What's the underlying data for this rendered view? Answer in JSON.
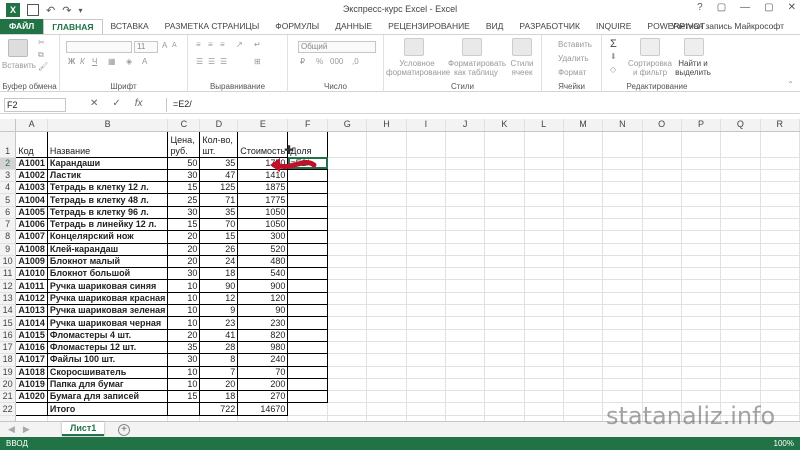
{
  "window": {
    "title": "Экспресс-курс Excel - Excel",
    "controls": [
      "?",
      "▢",
      "—",
      "▢",
      "✕"
    ]
  },
  "ribbon_tabs": {
    "file": "ФАЙЛ",
    "items": [
      "ГЛАВНАЯ",
      "ВСТАВКА",
      "РАЗМЕТКА СТРАНИЦЫ",
      "ФОРМУЛЫ",
      "ДАННЫЕ",
      "РЕЦЕНЗИРОВАНИЕ",
      "ВИД",
      "РАЗРАБОТЧИК",
      "INQUIRE",
      "POWERPIVOT"
    ],
    "active": "ГЛАВНАЯ",
    "account": "Учетная запись Майкрософт"
  },
  "ribbon": {
    "groups": {
      "clipboard": "Буфер обмена",
      "font": "Шрифт",
      "alignment": "Выравнивание",
      "number": "Число",
      "styles": "Стили",
      "cells": "Ячейки",
      "editing": "Редактирование"
    },
    "paste": "Вставить",
    "font_size": "11",
    "number_format": "Общий",
    "cond_format": "Условное форматирование",
    "format_table": "Форматировать как таблицу",
    "cell_styles": "Стили ячеек",
    "insert": "Вставить",
    "delete": "Удалить",
    "format": "Формат",
    "sort_filter": "Сортировка и фильтр",
    "find_select": "Найти и выделить"
  },
  "formula_bar": {
    "name_box": "F2",
    "formula": "=E2/",
    "cancel": "✕",
    "enter": "✓",
    "fx": "fx"
  },
  "grid": {
    "columns": [
      "A",
      "B",
      "C",
      "D",
      "E",
      "F",
      "G",
      "H",
      "I",
      "J",
      "K",
      "L",
      "M",
      "N",
      "O",
      "P",
      "Q",
      "R"
    ],
    "selected_column": "F",
    "selected_row": "2",
    "header": {
      "row": "1",
      "code": "Код",
      "name": "Название",
      "price_l1": "Цена,",
      "price_l2": "руб.",
      "qty_l1": "Кол-во,",
      "qty_l2": "шт.",
      "cost": "Стоимость",
      "share": "Доля"
    },
    "rows": [
      {
        "r": "2",
        "code": "А1001",
        "name": "Карандаши",
        "price": "50",
        "qty": "35",
        "cost": "1750",
        "f": "=E2/"
      },
      {
        "r": "3",
        "code": "А1002",
        "name": "Ластик",
        "price": "30",
        "qty": "47",
        "cost": "1410",
        "f": ""
      },
      {
        "r": "4",
        "code": "А1003",
        "name": "Тетрадь в клетку 12 л.",
        "price": "15",
        "qty": "125",
        "cost": "1875",
        "f": ""
      },
      {
        "r": "5",
        "code": "А1004",
        "name": "Тетрадь в клетку 48 л.",
        "price": "25",
        "qty": "71",
        "cost": "1775",
        "f": ""
      },
      {
        "r": "6",
        "code": "А1005",
        "name": "Тетрадь в клетку 96 л.",
        "price": "30",
        "qty": "35",
        "cost": "1050",
        "f": ""
      },
      {
        "r": "7",
        "code": "А1006",
        "name": "Тетрадь в линейку 12 л.",
        "price": "15",
        "qty": "70",
        "cost": "1050",
        "f": ""
      },
      {
        "r": "8",
        "code": "А1007",
        "name": "Концелярский нож",
        "price": "20",
        "qty": "15",
        "cost": "300",
        "f": ""
      },
      {
        "r": "9",
        "code": "А1008",
        "name": "Клей-карандаш",
        "price": "20",
        "qty": "26",
        "cost": "520",
        "f": ""
      },
      {
        "r": "10",
        "code": "А1009",
        "name": "Блокнот малый",
        "price": "20",
        "qty": "24",
        "cost": "480",
        "f": ""
      },
      {
        "r": "11",
        "code": "А1010",
        "name": "Блокнот большой",
        "price": "30",
        "qty": "18",
        "cost": "540",
        "f": ""
      },
      {
        "r": "12",
        "code": "А1011",
        "name": "Ручка шариковая синяя",
        "price": "10",
        "qty": "90",
        "cost": "900",
        "f": ""
      },
      {
        "r": "13",
        "code": "А1012",
        "name": "Ручка шариковая красная",
        "price": "10",
        "qty": "12",
        "cost": "120",
        "f": ""
      },
      {
        "r": "14",
        "code": "А1013",
        "name": "Ручка шариковая зеленая",
        "price": "10",
        "qty": "9",
        "cost": "90",
        "f": ""
      },
      {
        "r": "15",
        "code": "А1014",
        "name": "Ручка шариковая черная",
        "price": "10",
        "qty": "23",
        "cost": "230",
        "f": ""
      },
      {
        "r": "16",
        "code": "А1015",
        "name": "Фломастеры 4 шт.",
        "price": "20",
        "qty": "41",
        "cost": "820",
        "f": ""
      },
      {
        "r": "17",
        "code": "А1016",
        "name": "Фломастеры 12 шт.",
        "price": "35",
        "qty": "28",
        "cost": "980",
        "f": ""
      },
      {
        "r": "18",
        "code": "А1017",
        "name": "Файлы 100 шт.",
        "price": "30",
        "qty": "8",
        "cost": "240",
        "f": ""
      },
      {
        "r": "19",
        "code": "А1018",
        "name": "Скоросшиватель",
        "price": "10",
        "qty": "7",
        "cost": "70",
        "f": ""
      },
      {
        "r": "20",
        "code": "А1019",
        "name": "Папка для бумаг",
        "price": "10",
        "qty": "20",
        "cost": "200",
        "f": ""
      },
      {
        "r": "21",
        "code": "А1020",
        "name": "Бумага для записей",
        "price": "15",
        "qty": "18",
        "cost": "270",
        "f": ""
      }
    ],
    "total": {
      "r": "22",
      "label": "Итого",
      "qty": "722",
      "cost": "14670"
    }
  },
  "sheet_tabs": {
    "active": "Лист1",
    "add": "+"
  },
  "status": {
    "mode": "ВВОД",
    "zoom": "100%"
  },
  "watermark": "statanaliz.info",
  "colors": {
    "accent": "#217346",
    "arrow": "#c0102a"
  }
}
